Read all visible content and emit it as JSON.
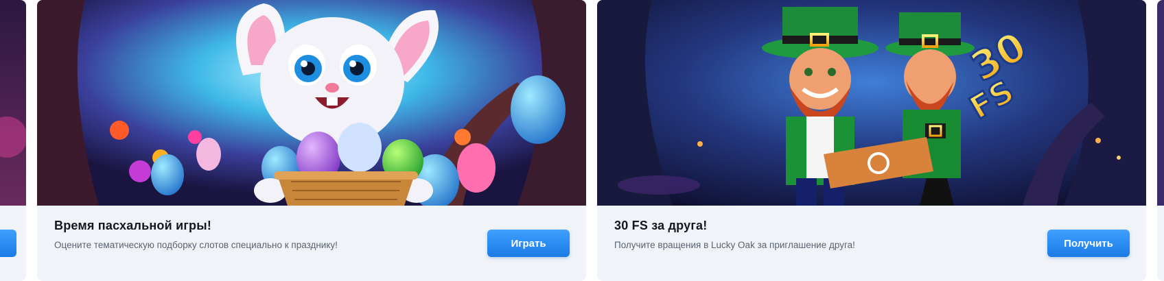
{
  "promos": [
    {
      "title": "Время пасхальной игры!",
      "description": "Оцените тематическую подборку слотов специально к празднику!",
      "button_label": "Играть",
      "image": "easter-bunny-slot-art"
    },
    {
      "title": "30 FS за друга!",
      "description": "Получите вращения в Lucky Oak за приглашение друга!",
      "button_label": "Получить",
      "image": "leprechauns-slot-art",
      "badge": "30 FS"
    }
  ],
  "colors": {
    "card_bg": "#f0f3f8",
    "button": "#2a8ff2",
    "title": "#15171c",
    "description": "#5a6170"
  }
}
